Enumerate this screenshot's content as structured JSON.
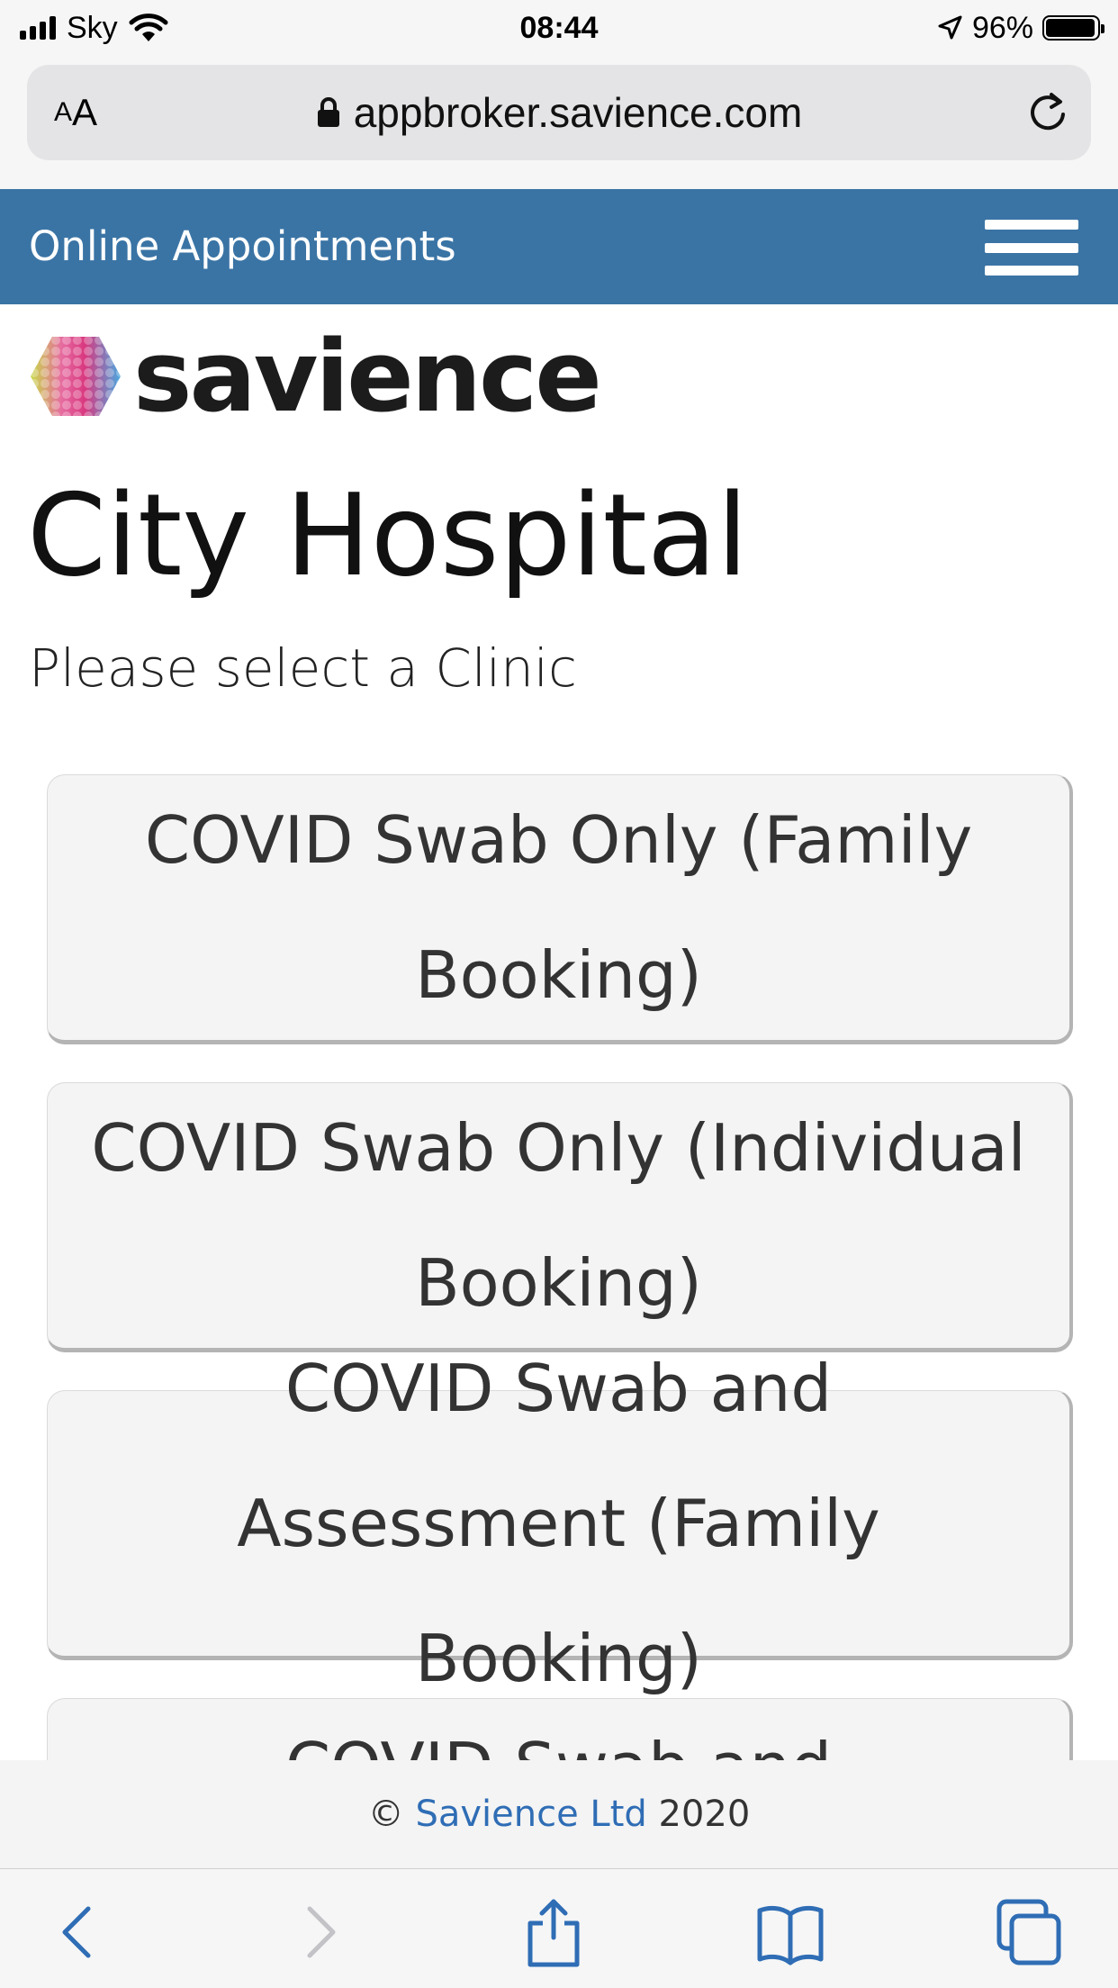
{
  "status_bar": {
    "carrier": "Sky",
    "time": "08:44",
    "battery": "96%",
    "battery_level": 0.96
  },
  "browser": {
    "text_size_small": "A",
    "text_size_big": "A",
    "url": "appbroker.savience.com"
  },
  "header": {
    "title": "Online Appointments"
  },
  "brand": {
    "logo_text": "savience"
  },
  "page": {
    "title": "City Hospital",
    "subtitle": "Please select a Clinic"
  },
  "clinics": [
    {
      "label": "COVID Swab Only (Family Booking)"
    },
    {
      "label": "COVID Swab Only (Individual Booking)"
    },
    {
      "label": "COVID Swab and Assessment (Family Booking)"
    },
    {
      "label": "COVID Swab and Assessment (Individual Booking)"
    }
  ],
  "footer": {
    "copyright": "©",
    "company_link": "Savience Ltd",
    "year": "2020"
  },
  "colors": {
    "header_blue": "#3a74a5",
    "ios_blue": "#2f6db5",
    "button_bg": "#f4f4f4"
  }
}
